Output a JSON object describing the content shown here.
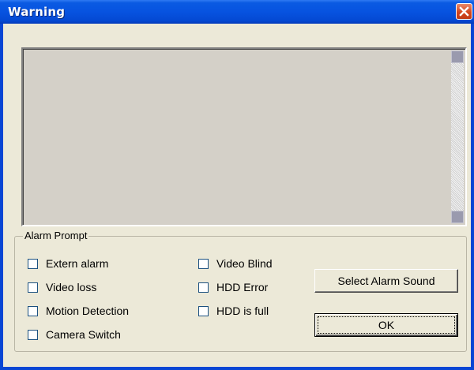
{
  "window": {
    "title": "Warning",
    "close_icon": "close-x-icon",
    "colors": {
      "titlebar": "#0753e0",
      "frame": "#0846d4",
      "face": "#ece9d8",
      "close": "#d3451f"
    }
  },
  "log_list": {
    "items": [],
    "scroll_icons": [
      "scroll-up-icon",
      "scroll-down-icon"
    ]
  },
  "alarm_prompt": {
    "label": "Alarm Prompt",
    "checkboxes": [
      {
        "label": "Extern alarm",
        "checked": false
      },
      {
        "label": "Video loss",
        "checked": false
      },
      {
        "label": "Motion Detection",
        "checked": false
      },
      {
        "label": "Camera Switch",
        "checked": false
      },
      {
        "label": "Video Blind",
        "checked": false
      },
      {
        "label": "HDD Error",
        "checked": false
      },
      {
        "label": "HDD is full",
        "checked": false
      }
    ],
    "select_sound_label": "Select Alarm Sound",
    "ok_label": "OK"
  }
}
